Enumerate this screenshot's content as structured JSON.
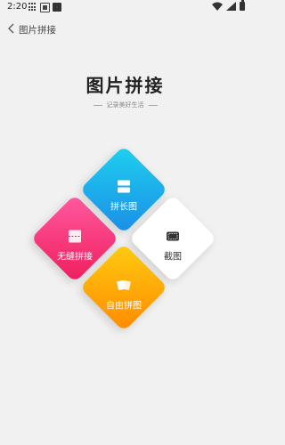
{
  "status_bar": {
    "time": "2:20"
  },
  "header": {
    "title": "图片拼接"
  },
  "hero": {
    "title": "图片拼接",
    "subtitle": "记录美好生活"
  },
  "tiles": {
    "long": {
      "label": "拼长图"
    },
    "seamless": {
      "label": "无缝拼接"
    },
    "screenshot": {
      "label": "截图"
    },
    "free": {
      "label": "自由拼图"
    }
  },
  "colors": {
    "background": "#f1f1f1",
    "long_tile": "#1a8ee6",
    "seamless_tile": "#ef1d5c",
    "screenshot_tile": "#ffffff",
    "free_tile": "#ff8a00"
  }
}
